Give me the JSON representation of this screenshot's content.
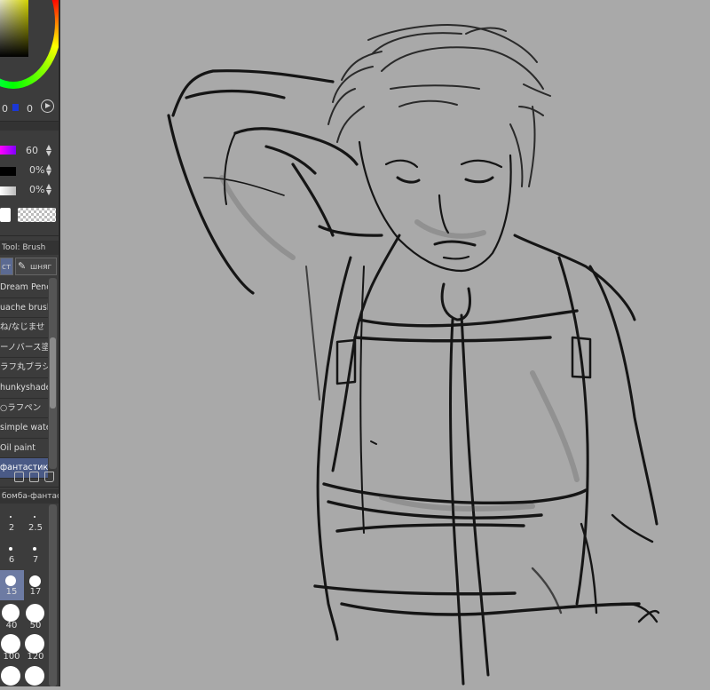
{
  "color_panel": {
    "rgb": [
      "0",
      "0"
    ]
  },
  "sliders": [
    {
      "value": "60",
      "gradient": "magenta-to-purple"
    },
    {
      "value": "0%",
      "gradient": "black"
    },
    {
      "value": "0%",
      "gradient": "white-gray"
    }
  ],
  "tool_header": "Tool: Brush",
  "tabs": [
    {
      "label": "ст"
    },
    {
      "label": "шняг"
    }
  ],
  "brushes": [
    {
      "label": "Dream Pencil"
    },
    {
      "label": "uache brush"
    },
    {
      "label": "ね/なじませ"
    },
    {
      "label": "ーノバース塗"
    },
    {
      "label": "ラフ丸ブラシ"
    },
    {
      "label": "hunkyshader"
    },
    {
      "label": "○ラフペン"
    },
    {
      "label": "simple water"
    },
    {
      "label": "Oil paint"
    },
    {
      "label": "фантастик",
      "selected": true
    }
  ],
  "size_header": "бомба-фантас",
  "sizes": [
    "2",
    "2.5",
    "6",
    "7",
    "15",
    "17",
    "40",
    "50",
    "100",
    "120"
  ],
  "selected_size": "15",
  "colors": {
    "panel_bg": "#3c3c3c",
    "canvas_bg": "#a9a9a9",
    "accent": "#4a5a86",
    "ink": "#151515"
  }
}
